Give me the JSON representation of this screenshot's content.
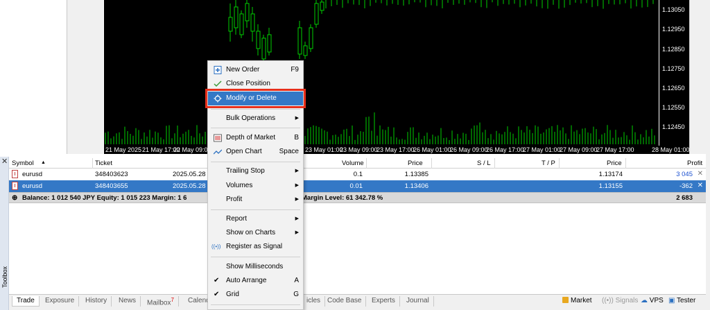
{
  "chart": {
    "price_labels": [
      "1.13050",
      "1.12950",
      "1.12850",
      "1.12750",
      "1.12650",
      "1.12550",
      "1.12450"
    ],
    "time_labels": [
      "21 May 2025",
      "21 May 17:00",
      "22 May 09:0",
      "23 May 01:00",
      "23 May 09:00",
      "23 May 17:00",
      "26 May 01:00",
      "26 May 09:00",
      "26 May 17:00",
      "27 May 01:00",
      "27 May 09:00",
      "27 May 17:00",
      "28 May 01:00"
    ]
  },
  "table": {
    "headers": {
      "symbol": "Symbol",
      "ticket": "Ticket",
      "volume": "Volume",
      "price": "Price",
      "sl": "S / L",
      "tp": "T / P",
      "price2": "Price",
      "profit": "Profit"
    },
    "sort_indicator": "▲",
    "rows": [
      {
        "symbol": "eurusd",
        "ticket": "348403623",
        "time": "2025.05.28",
        "volume": "0.1",
        "price": "1.13385",
        "price2": "1.13174",
        "profit": "3 045"
      },
      {
        "symbol": "eurusd",
        "ticket": "348403655",
        "time": "2025.05.28",
        "volume": "0.01",
        "price": "1.13406",
        "price2": "1.13155",
        "profit": "-362"
      }
    ],
    "summary_left": "Balance: 1 012 540 JPY  Equity: 1 015 223  Margin: 1 6",
    "summary_right": "Margin Level: 61 342.78 %",
    "summary_profit": "2 683",
    "close_symbol": "✕"
  },
  "toolbox": {
    "label": "Toolbox",
    "close": "✕"
  },
  "tabs": [
    {
      "label": "Trade",
      "active": true
    },
    {
      "label": "Exposure"
    },
    {
      "label": "History"
    },
    {
      "label": "News"
    },
    {
      "label": "Mailbox",
      "badge": "7"
    },
    {
      "label": "Calend"
    },
    {
      "label": "icles"
    },
    {
      "label": "Code Base"
    },
    {
      "label": "Experts"
    },
    {
      "label": "Journal"
    }
  ],
  "right_tabs": {
    "market": "Market",
    "signals": "Signals",
    "vps": "VPS",
    "tester": "Tester"
  },
  "menu": {
    "new_order": "New Order",
    "new_order_sc": "F9",
    "close_position": "Close Position",
    "modify": "Modify or Delete",
    "bulk": "Bulk Operations",
    "depth": "Depth of Market",
    "depth_sc": "B",
    "open_chart": "Open Chart",
    "open_chart_sc": "Space",
    "trailing": "Trailing Stop",
    "volumes": "Volumes",
    "profit": "Profit",
    "report": "Report",
    "show_on_charts": "Show on Charts",
    "register": "Register as Signal",
    "show_ms": "Show Milliseconds",
    "auto_arrange": "Auto Arrange",
    "auto_arrange_sc": "A",
    "grid": "Grid",
    "grid_sc": "G"
  },
  "colors": {
    "selection": "#3478c6",
    "highlight_outline": "#e8301c",
    "candle": "#00d000",
    "profit_blue": "#1a4fd0"
  }
}
